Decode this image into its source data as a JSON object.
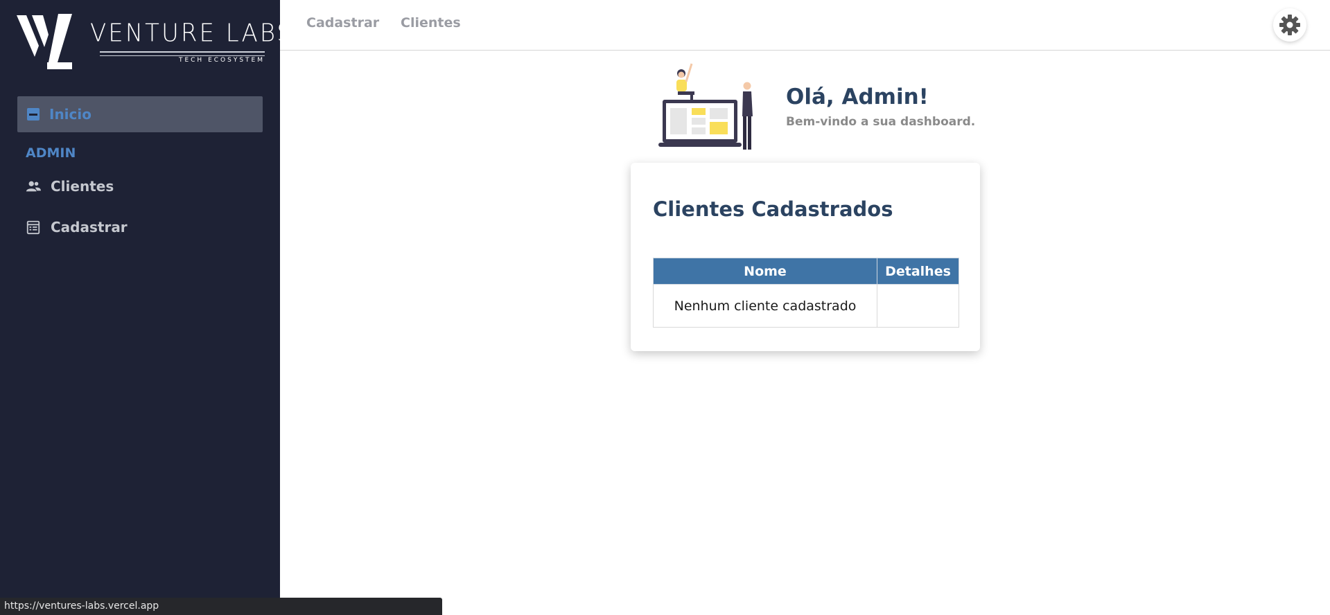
{
  "brand": {
    "name": "VENTURE LABS",
    "tagline": "TECH ECOSYSTEM"
  },
  "sidebar": {
    "active_item": {
      "label": "Inicio",
      "icon": "minus-square-icon"
    },
    "section_title": "ADMIN",
    "items": [
      {
        "label": "Clientes",
        "icon": "users-icon"
      },
      {
        "label": "Cadastrar",
        "icon": "form-icon"
      }
    ]
  },
  "topbar": {
    "links": [
      "Cadastrar",
      "Clientes"
    ],
    "settings_icon": "gear-icon"
  },
  "greeting": {
    "title": "Olá, Admin!",
    "subtitle": "Bem-vindo a sua dashboard."
  },
  "card": {
    "title": "Clientes Cadastrados",
    "table": {
      "headers": [
        "Nome",
        "Detalhes"
      ],
      "empty_message": "Nenhum cliente cadastrado"
    }
  },
  "status_bar": {
    "url": "https://ventures-labs.vercel.app"
  },
  "colors": {
    "sidebar_bg": "#1e2235",
    "accent": "#4f86c6",
    "heading": "#2b4361",
    "table_header": "#3f74a6",
    "illustration_yellow": "#f9de59"
  }
}
